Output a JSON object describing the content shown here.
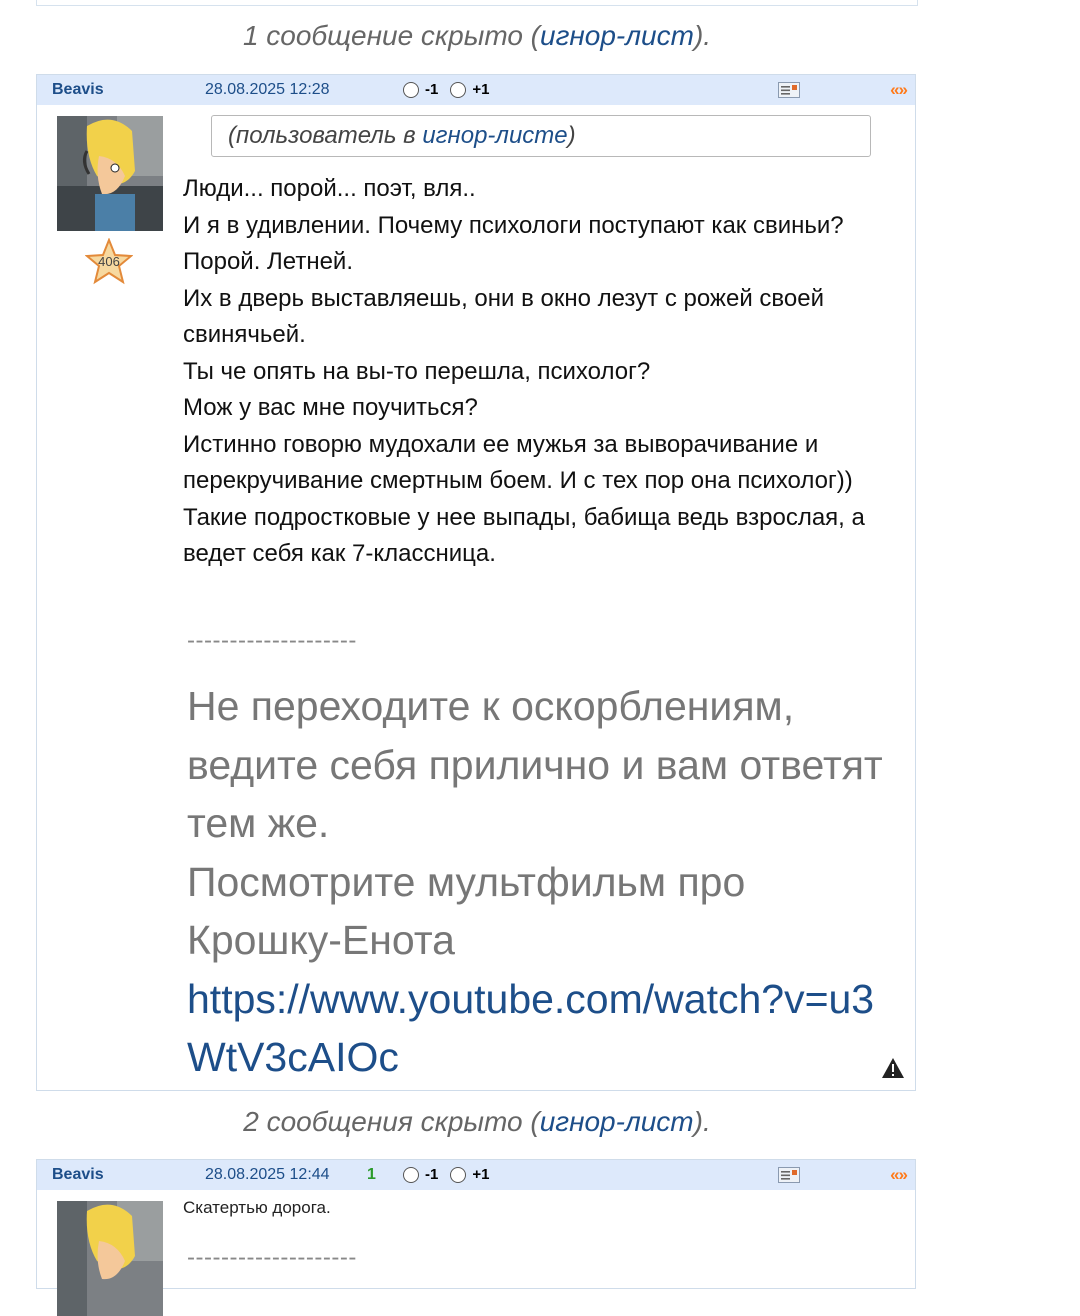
{
  "notices": {
    "first": {
      "prefix": "1 сообщение скрыто (",
      "link": "игнор-лист",
      "suffix": ")."
    },
    "second": {
      "prefix": "2 сообщения скрыто (",
      "link": "игнор-лист",
      "suffix": ")."
    }
  },
  "post1": {
    "author": "Beavis",
    "date": "28.08.2025 12:28",
    "vote_minus": "-1",
    "vote_plus": "+1",
    "quote_icon": "«»",
    "rating_badge": "406",
    "ignore_prefix": "(пользователь в ",
    "ignore_link": "игнор-листе",
    "ignore_suffix": ")",
    "lines": [
      "Люди... порой... поэт, вля..",
      "И я в удивлении. Почему психологи поступают как свиньи? Порой. Летней.",
      "Их в дверь выставляешь, они в окно лезут с рожей своей свинячьей.",
      "Ты че опять на вы-то перешла, психолог?",
      "Мож у вас мне поучиться?",
      "Истинно говорю мудохали ее мужья за выворачивание и перекручивание смертным боем. И с тех пор она психолог))",
      "Такие подростковые у нее выпады, бабища ведь взрослая, а ведет себя как 7-классница."
    ],
    "sig_dashes": "--------------------",
    "sig_lines": [
      "Не переходите к оскорблениям, ведите себя прилично и вам ответят тем же.",
      "Посмотрите мультфильм про Крошку-Енота"
    ],
    "sig_link": "https://www.youtube.com/watch?v=u3WtV3cAIOc"
  },
  "post2": {
    "author": "Beavis",
    "date": "28.08.2025 12:44",
    "score": "1",
    "vote_minus": "-1",
    "vote_plus": "+1",
    "quote_icon": "«»",
    "text": "Скатертью дорога.",
    "sig_dashes": "--------------------"
  },
  "colors": {
    "header_bg": "#dde9fb",
    "link": "#1d4e89",
    "quote": "#ff7a1a",
    "score": "#2b9a2b"
  },
  "icons": [
    "business-card-icon",
    "quote-icon",
    "warning-icon",
    "star-badge-icon",
    "radio-icon"
  ]
}
